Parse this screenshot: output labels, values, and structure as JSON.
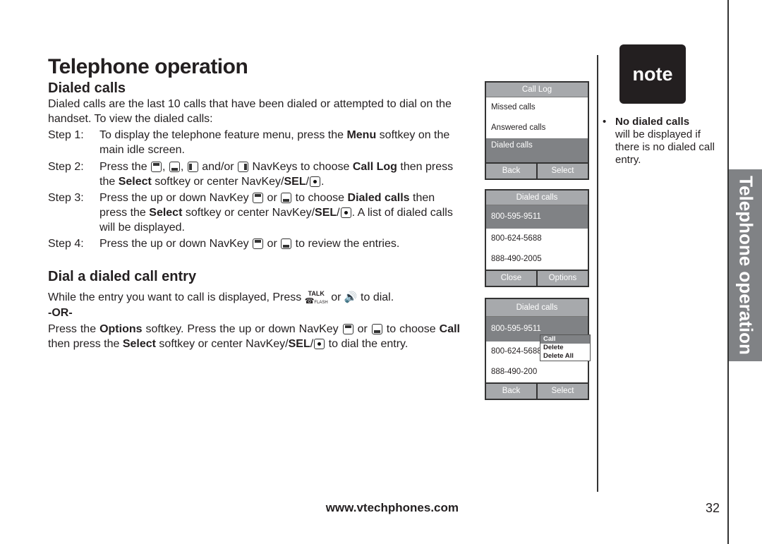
{
  "title": "Telephone operation",
  "section1": {
    "heading": "Dialed calls",
    "intro": "Dialed calls are the last 10 calls that have been dialed or attempted to dial on the handset. To view the dialed calls:",
    "steps": [
      {
        "n": "Step 1:",
        "a": "To display the telephone feature menu, press the ",
        "b1": "Menu",
        "c": " softkey on the main idle screen."
      },
      {
        "n": "Step 2:",
        "a": "Press the ",
        "b": " and/or ",
        "c": " NavKeys to choose ",
        "b1": "Call Log",
        "d": " then press the ",
        "b2": "Select",
        "e": " softkey or center NavKey/",
        "b3": "SEL",
        "f": "/"
      },
      {
        "n": "Step 3:",
        "a": "Press the up or down NavKey ",
        "b": " or ",
        "c": " to choose ",
        "b1": "Dialed calls",
        "d": " then press the ",
        "b2": "Select",
        "e": " softkey or center NavKey/",
        "b3": "SEL",
        "f": "/",
        "g": ". A list of dialed calls will be displayed."
      },
      {
        "n": "Step 4:",
        "a": "Press the up or down NavKey ",
        "b": " or ",
        "c": " to review the entries."
      }
    ]
  },
  "section2": {
    "heading": "Dial a dialed call entry",
    "line1a": "While the entry you want to call is displayed, Press ",
    "talk": "TALK",
    "flash": "FLASH",
    "line1b": " or ",
    "line1c": " to dial.",
    "or": "-OR-",
    "p2a": "Press the ",
    "p2b": "Options",
    "p2c": " softkey. Press the up or down NavKey ",
    "p2d": " or ",
    "p2e": " to choose ",
    "p2f": "Call",
    "p2g": " then press the ",
    "p2h": "Select",
    "p2i": " softkey or center NavKey/",
    "p2j": "SEL",
    "p2k": "/",
    "p2l": " to dial the entry."
  },
  "screens": [
    {
      "header": "Call Log",
      "rows": [
        "Missed calls",
        "Answered calls",
        "Dialed calls"
      ],
      "left": "Back",
      "right": "Select"
    },
    {
      "header": "Dialed calls",
      "rows": [
        "800-595-9511",
        "800-624-5688",
        "888-490-2005"
      ],
      "left": "Close",
      "right": "Options"
    },
    {
      "header": "Dialed calls",
      "rows": [
        "800-595-9511",
        "800-624-5688",
        "888-490-200"
      ],
      "menu": [
        "Call",
        "Delete",
        "Delete All"
      ],
      "left": "Back",
      "right": "Select"
    }
  ],
  "note": {
    "logo": "note",
    "bold": "No dialed calls",
    "text": "will be displayed if there is no dialed call entry."
  },
  "side_tab": "Telephone operation",
  "footer": {
    "url": "www.vtechphones.com",
    "page": "32"
  },
  "colors": {
    "tab": "#808285",
    "highlight": "#808285",
    "header": "#a7a9ac"
  }
}
